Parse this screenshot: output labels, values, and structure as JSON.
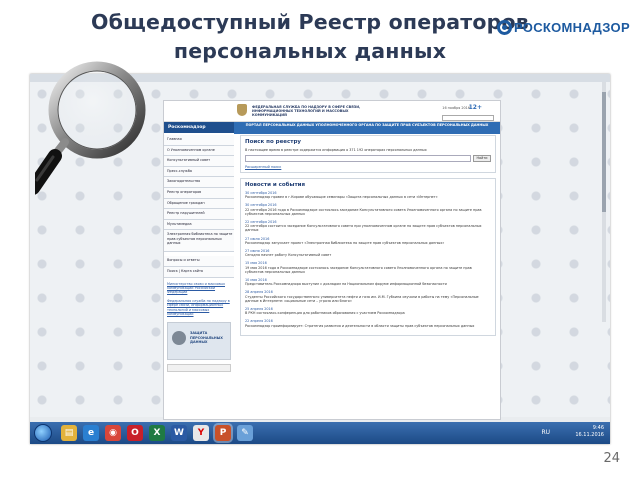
{
  "slide": {
    "title_line1": "Общедоступный Реестр операторов",
    "title_line2": "персональных данных",
    "logo_text": "РОСКОМНАДЗОР",
    "page_number": "24"
  },
  "site": {
    "brand": "Роскомнадзор",
    "header_text": "Федеральная служба по надзору в сфере связи, информационных технологий и массовых коммуникаций",
    "header_right": "16 ноября 2016",
    "header_badge": "12+",
    "blue_bar": "Портал персональных данных Уполномоченного органа по защите прав субъектов персональных данных",
    "nav": [
      "Главная",
      "О Уполномоченном органе",
      "Консультативный совет",
      "Пресс-служба",
      "Законодательство",
      "Реестр операторов",
      "Обращение граждан",
      "Реестр нарушителей",
      "Мультимедиа",
      "Электронная библиотека по защите прав субъектов персональных данных"
    ],
    "nav_extra": [
      "Вопросы и ответы",
      "Поиск | Карта сайта"
    ],
    "nav_links": [
      "Министерство связи и массовых коммуникаций Российской Федерации",
      "Федеральная служба по надзору в сфере связи, информационных технологий и массовых коммуникаций"
    ],
    "banner_text": "Защита персональных данных",
    "search": {
      "heading": "Поиск по реестру",
      "info": "В настоящее время в реестре содержится информация о 371 192 операторах персональных данных",
      "button": "Найти",
      "advanced": "Расширенный поиск"
    },
    "news": {
      "heading": "Новости и события",
      "items": [
        {
          "date": "30 сентября 2016",
          "text": "Роскомнадзор провел в г.Кирове обучающие семинары «Защита персональных данных в сети «Интернет»"
        },
        {
          "date": "30 сентября 2016",
          "text": "22 сентября 2016 года в Роскомнадзоре состоялось заседание Консультативного совета Уполномоченного органа по защите прав субъектов персональных данных"
        },
        {
          "date": "22 сентября 2016",
          "text": "22 сентября состоится заседание Консультативного совета при уполномоченном органе по защите прав субъектов персональных данных"
        },
        {
          "date": "27 июля 2016",
          "text": "Роскомнадзор запускает проект «Электронная библиотека по защите прав субъектов персональных данных»"
        },
        {
          "date": "27 июня 2016",
          "text": "Сегодня начнет работу Консультативный совет"
        },
        {
          "date": "15 мая 2016",
          "text": "19 мая 2016 года в Роскомнадзоре состоялось заседание Консультативного совета Уполномоченного органа по защите прав субъектов персональных данных"
        },
        {
          "date": "10 мая 2016",
          "text": "Представитель Роскомнадзора выступил с докладом на Национальном форуме информационной безопасности"
        },
        {
          "date": "28 апреля 2016",
          "text": "Студенты Российского государственного университета нефти и газа им. И.М. Губкина изучили в работы на тему «Персональные данные в Интернете: социальные сети – угроза или благо»"
        },
        {
          "date": "25 апреля 2016",
          "text": "В РКН состоялась конференция для работников образования с участием Роскомнадзора"
        },
        {
          "date": "22 апреля 2016",
          "text": "Роскомнадзор проинформирует: Стратегия развития и деятельности в области защиты прав субъектов персональных данных"
        }
      ]
    }
  },
  "taskbar": {
    "icons": [
      "windows-explorer",
      "internet-explorer",
      "google-chrome",
      "opera",
      "excel",
      "word",
      "yandex-browser",
      "powerpoint",
      "paint"
    ],
    "lang": "RU",
    "time": "9:46",
    "date": "16.11.2016"
  },
  "colors": {
    "title": "#2c3a56",
    "brand_blue": "#1d5aa0",
    "site_bar": "#2f6db4",
    "taskbar": "#1c4a86"
  }
}
